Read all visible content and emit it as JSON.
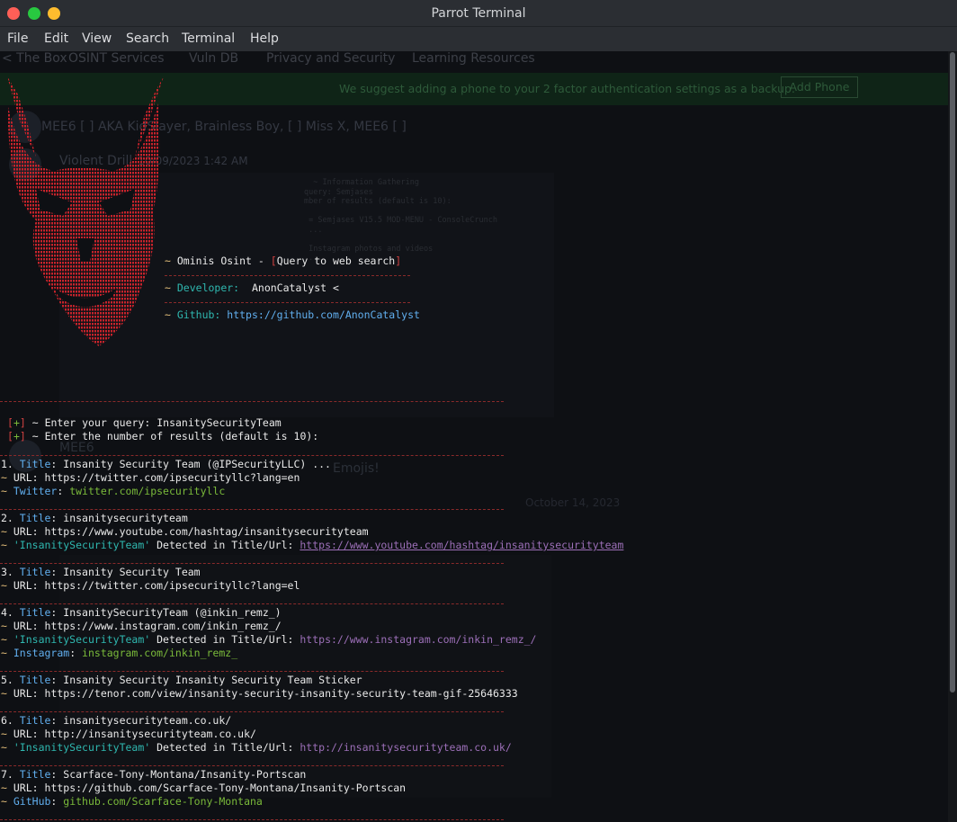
{
  "window": {
    "title": "Parrot Terminal"
  },
  "menu": [
    "File",
    "Edit",
    "View",
    "Search",
    "Terminal",
    "Help"
  ],
  "background_page": {
    "bookmarks": [
      "< The Box",
      "OSINT Services",
      "Vuln DB",
      "Privacy and Security",
      "Learning Resources"
    ],
    "banner_text": "We suggest adding a phone to your 2 factor authentication settings as a backup.",
    "banner_button": "Add Phone",
    "chat_line_1": "MEE6 [ ] AKA KidSlayer, Brainless Boy, [ ] Miss X, MEE6 [ ]",
    "chat_author": "Violent Drill",
    "chat_time": "10/09/2023 1:42 AM",
    "mee6_label": "MEE6",
    "emoji_text": "Emojis!",
    "date_divider": "October 14, 2023"
  },
  "header": {
    "tool_name": "Ominis Osint",
    "tool_desc": "Query to web search",
    "developer_label": "Developer:",
    "developer": "AnonCatalyst <",
    "github_label": "Github:",
    "github_url": "https://github.com/AnonCatalyst"
  },
  "prompts": {
    "query_prefix": "[+]",
    "query_label": " ~ Enter your query: ",
    "query_value": "InsanitySecurityTeam",
    "count_label": " ~ Enter the number of results (default is 10):"
  },
  "results": [
    {
      "title": "Insanity Security Team (@IPSecurityLLC) ...",
      "url": "https://twitter.com/ipsecurityllc?lang=en",
      "platform": "Twitter",
      "platform_value": "twitter.com/ipsecurityllc"
    },
    {
      "title": "insanitysecurityteam",
      "url": "https://www.youtube.com/hashtag/insanitysecurityteam",
      "detected": "'InsanitySecurityTeam'",
      "detected_suffix": " Detected in Title/Url: ",
      "detected_url": "https://www.youtube.com/hashtag/insanitysecurityteam"
    },
    {
      "title": "Insanity Security Team",
      "url": "https://twitter.com/ipsecurityllc?lang=el"
    },
    {
      "title": "InsanitySecurityTeam (@inkin_remz_)",
      "url": "https://www.instagram.com/inkin_remz_/",
      "detected": "'InsanitySecurityTeam'",
      "detected_suffix": " Detected in Title/Url: ",
      "detected_url": "https://www.instagram.com/inkin_remz_/",
      "platform": "Instagram",
      "platform_value": "instagram.com/inkin_remz_"
    },
    {
      "title": "Insanity Security Insanity Security Team Sticker",
      "url": "https://tenor.com/view/insanity-security-insanity-security-team-gif-25646333"
    },
    {
      "title": "insanitysecurityteam.co.uk/",
      "url": "http://insanitysecurityteam.co.uk/",
      "detected": "'InsanitySecurityTeam'",
      "detected_suffix": " Detected in Title/Url: ",
      "detected_url": "http://insanitysecurityteam.co.uk/"
    },
    {
      "title": "Scarface-Tony-Montana/Insanity-Portscan",
      "url": "https://github.com/Scarface-Tony-Montana/Insanity-Portscan",
      "platform": "GitHub",
      "platform_value": "github.com/Scarface-Tony-Montana"
    }
  ],
  "labels": {
    "title": "Title",
    "url": "URL:",
    "tilde": "~"
  },
  "colors": {
    "accent_red": "#d24242",
    "link_purple": "#9c6fb8",
    "platform_green": "#7aba3a",
    "label_blue": "#61afef"
  }
}
